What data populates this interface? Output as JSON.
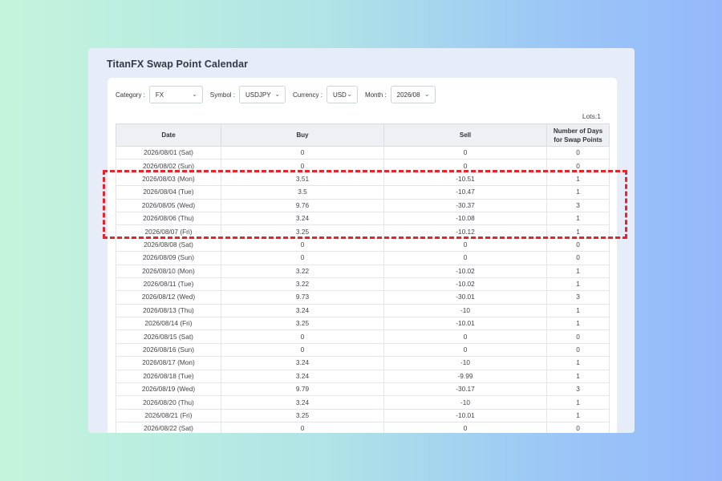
{
  "window": {
    "title": "TitanFX Swap Point Calendar"
  },
  "filters": {
    "category_label": "Category :",
    "category_value": "FX",
    "symbol_label": "Symbol :",
    "symbol_value": "USDJPY",
    "currency_label": "Currency :",
    "currency_value": "USD",
    "month_label": "Month :",
    "month_value": "2026/08",
    "chevron_icon": "chevron-down-icon"
  },
  "lots": "Lots:1",
  "table": {
    "headers": [
      "Date",
      "Buy",
      "Sell",
      "Number of Days\nfor Swap Points"
    ],
    "rows": [
      [
        "2026/08/01 (Sat)",
        "0",
        "0",
        "0"
      ],
      [
        "2026/08/02 (Sun)",
        "0",
        "0",
        "0"
      ],
      [
        "2026/08/03 (Mon)",
        "3.51",
        "-10.51",
        "1"
      ],
      [
        "2026/08/04 (Tue)",
        "3.5",
        "-10.47",
        "1"
      ],
      [
        "2026/08/05 (Wed)",
        "9.76",
        "-30.37",
        "3"
      ],
      [
        "2026/08/06 (Thu)",
        "3.24",
        "-10.08",
        "1"
      ],
      [
        "2026/08/07 (Fri)",
        "3.25",
        "-10.12",
        "1"
      ],
      [
        "2026/08/08 (Sat)",
        "0",
        "0",
        "0"
      ],
      [
        "2026/08/09 (Sun)",
        "0",
        "0",
        "0"
      ],
      [
        "2026/08/10 (Mon)",
        "3.22",
        "-10.02",
        "1"
      ],
      [
        "2026/08/11 (Tue)",
        "3.22",
        "-10.02",
        "1"
      ],
      [
        "2026/08/12 (Wed)",
        "9.73",
        "-30.01",
        "3"
      ],
      [
        "2026/08/13 (Thu)",
        "3.24",
        "-10",
        "1"
      ],
      [
        "2026/08/14 (Fri)",
        "3.25",
        "-10.01",
        "1"
      ],
      [
        "2026/08/15 (Sat)",
        "0",
        "0",
        "0"
      ],
      [
        "2026/08/16 (Sun)",
        "0",
        "0",
        "0"
      ],
      [
        "2026/08/17 (Mon)",
        "3.24",
        "-10",
        "1"
      ],
      [
        "2026/08/18 (Tue)",
        "3.24",
        "-9.99",
        "1"
      ],
      [
        "2026/08/19 (Wed)",
        "9.79",
        "-30.17",
        "3"
      ],
      [
        "2026/08/20 (Thu)",
        "3.24",
        "-10",
        "1"
      ],
      [
        "2026/08/21 (Fri)",
        "3.25",
        "-10.01",
        "1"
      ],
      [
        "2026/08/22 (Sat)",
        "0",
        "0",
        "0"
      ]
    ]
  },
  "annotation": {
    "color": "#e3262e",
    "style": "dashed"
  }
}
